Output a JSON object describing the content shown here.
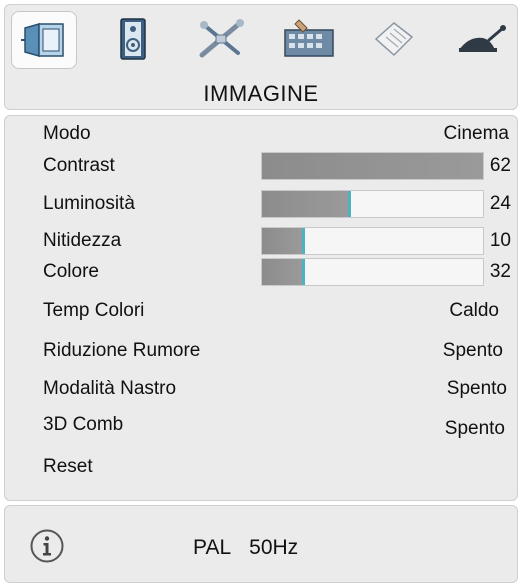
{
  "menu": {
    "title": "IMMAGINE",
    "tabs": [
      {
        "icon": "picture-icon",
        "selected": true
      },
      {
        "icon": "speaker-icon",
        "selected": false
      },
      {
        "icon": "tools-icon",
        "selected": false
      },
      {
        "icon": "setup-icon",
        "selected": false
      },
      {
        "icon": "document-icon",
        "selected": false
      },
      {
        "icon": "antenna-icon",
        "selected": false
      }
    ]
  },
  "settings": {
    "modo": {
      "label": "Modo",
      "value": "Cinema"
    },
    "contrast": {
      "label": "Contrast",
      "value": "62",
      "level": 1.0
    },
    "luminosita": {
      "label": "Luminosità",
      "value": "24",
      "level": 0.39
    },
    "nitidezza": {
      "label": "Nitidezza",
      "value": "10",
      "level": 0.18
    },
    "colore": {
      "label": "Colore",
      "value": "32",
      "level": 0.18
    },
    "temp_colori": {
      "label": "Temp Colori",
      "value": "Caldo"
    },
    "riduzione_rumore": {
      "label": "Riduzione Rumore",
      "value": "Spento"
    },
    "modalita_nastro": {
      "label": "Modalità Nastro",
      "value": "Spento"
    },
    "comb_3d": {
      "label": "3D Comb",
      "value": "Spento"
    },
    "reset": {
      "label": "Reset"
    }
  },
  "info": {
    "icon": "info-icon",
    "system": "PAL",
    "frequency": "50Hz"
  },
  "colors": {
    "panel": "#ebebeb",
    "bar_fill": "#8c8c8c",
    "bar_accent": "#4fb2c0"
  }
}
